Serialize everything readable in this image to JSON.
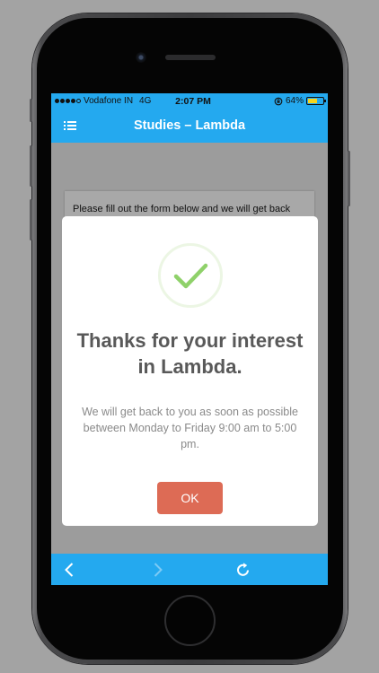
{
  "status_bar": {
    "carrier": "Vodafone IN",
    "network": "4G",
    "time": "2:07 PM",
    "battery": "64%",
    "battery_level": 0.64
  },
  "nav": {
    "title": "Studies – Lambda",
    "menu_icon": "list-menu-icon"
  },
  "background_card": {
    "text": "Please fill out the form below and we will get back"
  },
  "dialog": {
    "icon": "checkmark-success-icon",
    "title": "Thanks for your interest in Lambda.",
    "message": "We will get back to you as soon as possible between Monday to Friday 9:00 am to 5:00 pm.",
    "ok_label": "OK"
  },
  "toolbar": {
    "back_icon": "chevron-left-icon",
    "forward_icon": "chevron-right-icon",
    "reload_icon": "reload-icon"
  },
  "colors": {
    "accent": "#24a9ef",
    "ok_button": "#dd6b55",
    "check": "#8fd16a",
    "battery": "#f7d51d"
  }
}
